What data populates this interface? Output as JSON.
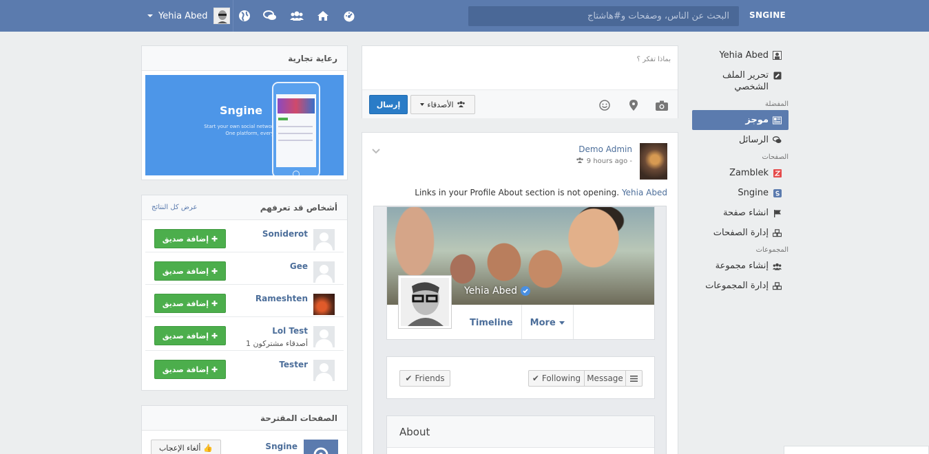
{
  "topbar": {
    "brand": "SNGINE",
    "search_placeholder": "البحث عن الناس، وصفحات و#هاشتاج",
    "user_name": "Yehia Abed",
    "icons": [
      "dashboard-icon",
      "home-icon",
      "friends-icon",
      "messages-icon",
      "globe-icon"
    ]
  },
  "right_sidebar": {
    "profile_name": "Yehia Abed",
    "edit_profile": "تحرير الملف الشخصي",
    "favorites_head": "المفضلة",
    "newsfeed": "موجز",
    "messages": "الرسائل",
    "pages_head": "الصفحات",
    "pages": [
      "Zamblek",
      "Sngine"
    ],
    "create_page": "انشاء صفحة",
    "manage_pages": "إدارة الصفحات",
    "groups_head": "المجموعات",
    "create_group": "إنشاء مجموعة",
    "manage_groups": "إدارة المجموعات"
  },
  "ad": {
    "title": "رعاية تجارية",
    "brand": "Sngine",
    "line1": "Start your own social network today",
    "line2": "One platform, every device"
  },
  "people": {
    "title": "أشخاص قد تعرفهم",
    "see_all": "عرض كل النتائج",
    "add_label": "إضافة صديق",
    "items": [
      {
        "name": "Soniderot",
        "sub": ""
      },
      {
        "name": "Gee",
        "sub": ""
      },
      {
        "name": "Rameshten",
        "sub": ""
      },
      {
        "name": "Lol Test",
        "sub": "1 أصدقاء مشتركون"
      },
      {
        "name": "Tester",
        "sub": ""
      }
    ]
  },
  "suggested_pages": {
    "title": "الصفحات المقترحة",
    "items": [
      {
        "name": "Sngine",
        "action": "ألغاء الإعجاب"
      }
    ]
  },
  "composer": {
    "placeholder": "بماذا تفكر ؟",
    "privacy": "الأصدقاء",
    "send": "إرسال"
  },
  "post": {
    "author": "Demo Admin",
    "time": "9 hours ago -",
    "text": "Links in your Profile About section is not opening.",
    "mention": "Yehia Abed",
    "embedded": {
      "name": "Yehia Abed",
      "tab_timeline": "Timeline",
      "tab_more": "More",
      "friends": "Friends",
      "following": "Following",
      "message": "Message",
      "about": "About"
    }
  },
  "colors": {
    "topbar": "#5b7bae",
    "accent": "#4c6e9a",
    "green": "#4cae4c",
    "send_blue": "#2a7cc7"
  }
}
